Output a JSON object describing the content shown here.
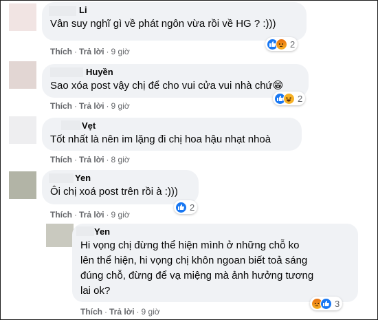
{
  "comments": [
    {
      "name": "Li",
      "text": "Vân suy nghĩ gì về phát ngôn vừa rồi về HG ? :)))",
      "like_label": "Thích",
      "reply_label": "Trả lời",
      "time": "9 giờ",
      "reaction_count": "2",
      "reactions": [
        "like-icon",
        "angry-icon"
      ]
    },
    {
      "name": "Huyền",
      "text": "Sao xóa post vậy chị để cho vui cửa vui nhà chứ😁",
      "like_label": "Thích",
      "reply_label": "Trả lời",
      "time": "9 giờ",
      "reaction_count": "2",
      "reactions": [
        "like-icon",
        "haha-icon"
      ]
    },
    {
      "name": "Vẹt",
      "text": "Tốt nhất là nên im lặng đi chị hoa hậu nhạt nhoà",
      "like_label": "Thích",
      "reply_label": "Trả lời",
      "time": "8 giờ"
    },
    {
      "name": "Yen",
      "text": "Ôi chị xoá post trên rồi à :)))",
      "like_label": "Thích",
      "reply_label": "Trả lời",
      "time": "9 giờ",
      "reaction_count": "2",
      "reactions": [
        "like-icon"
      ]
    },
    {
      "name": "Yen",
      "text_lines": [
        "Hi vọng chị đừng thể hiện mình ở những chỗ ko",
        "lên thể hiện, hi vọng chị khôn ngoan biết toả sáng",
        "đúng chỗ, đừng để vạ miệng mà ảnh hưởng tương",
        "lai ok?"
      ],
      "like_label": "Thích",
      "reply_label": "Trả lời",
      "time": "9 giờ",
      "reaction_count": "3",
      "reactions": [
        "angry-icon",
        "like-icon"
      ]
    }
  ],
  "colors": {
    "bubble": "#f0f2f5",
    "like": "#1877f2",
    "angry": "#e9710f",
    "secondary_text": "#65676b"
  }
}
